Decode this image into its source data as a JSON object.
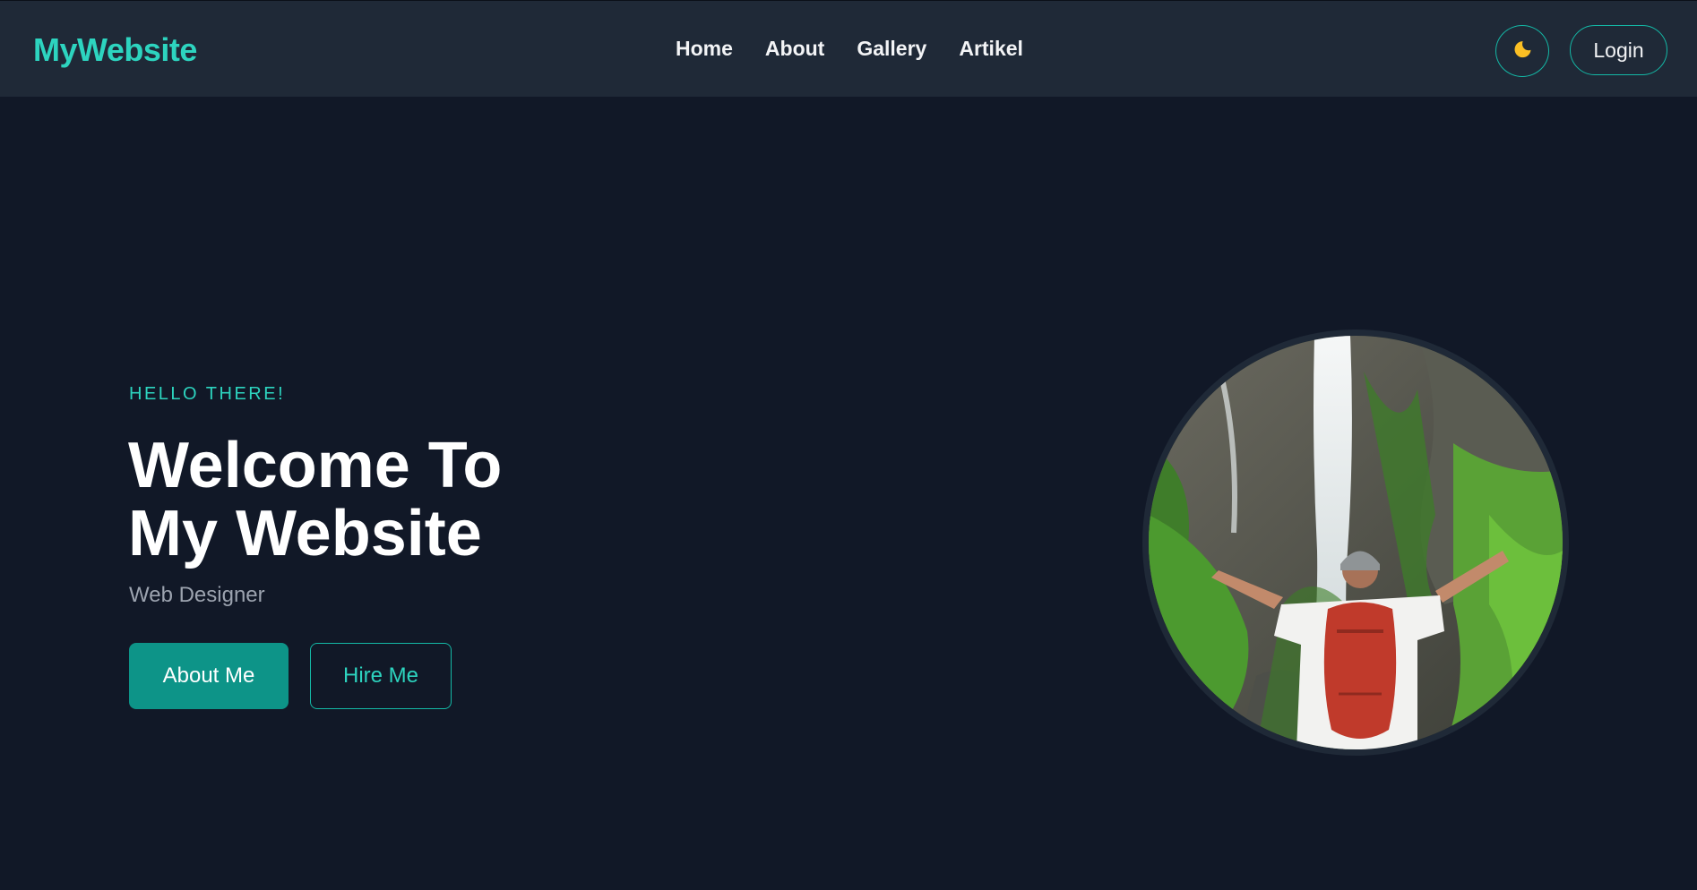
{
  "header": {
    "logo": "MyWebsite",
    "nav": [
      "Home",
      "About",
      "Gallery",
      "Artikel"
    ],
    "theme_icon": "moon-icon",
    "login_label": "Login"
  },
  "hero": {
    "greeting": "HELLO THERE!",
    "title_line1": "Welcome To",
    "title_line2": "My Website",
    "subtitle": "Web Designer",
    "primary_button": "About Me",
    "secondary_button": "Hire Me",
    "image_alt": "Hiker with red backpack in front of waterfall"
  },
  "colors": {
    "accent": "#2dd4bf",
    "accent_dark": "#0d9488",
    "background": "#111827",
    "navbar": "#1f2937"
  }
}
